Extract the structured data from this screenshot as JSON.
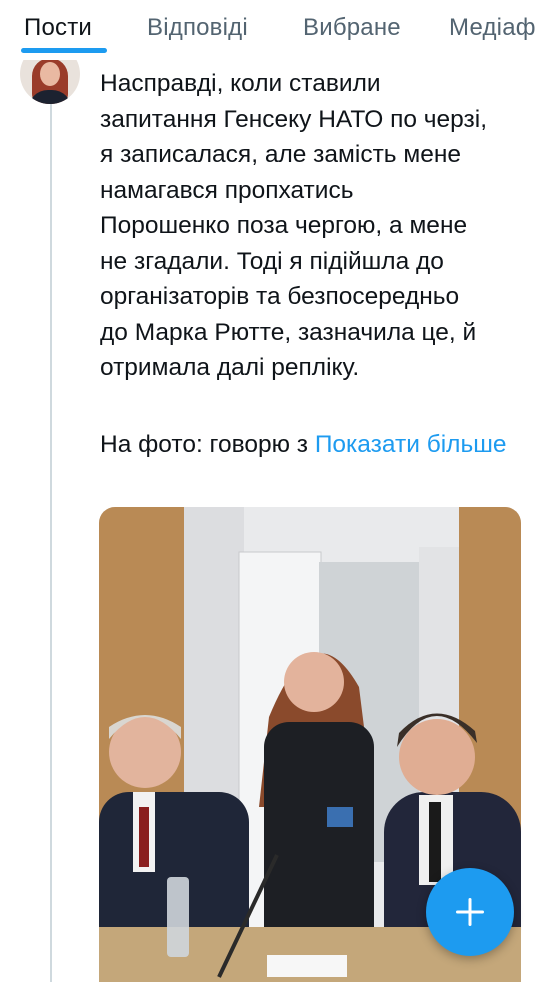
{
  "tabs": [
    {
      "label": "Пости",
      "active": true
    },
    {
      "label": "Відповіді",
      "active": false
    },
    {
      "label": "Вибране",
      "active": false
    },
    {
      "label": "Медіаф",
      "active": false
    }
  ],
  "post": {
    "text": "Насправді, коли ставили\nзапитання Генсеку НАТО по черзі,\nя записалася, але замість мене\nнамагався пропхатись\nПорошенко поза чергою, а мене\nне згадали. Тоді я підійшла до\nорганізаторів та безпосередньо\nдо Марка Рютте, зазначила це, й\nотримала далі репліку.",
    "teaser": "На фото: говорю з",
    "show_more": "Показати більше"
  },
  "fab": {
    "icon": "plus-icon",
    "color": "#1d9bf0"
  },
  "colors": {
    "accent": "#1d9bf0",
    "text": "#0f1419",
    "muted": "#536471"
  }
}
